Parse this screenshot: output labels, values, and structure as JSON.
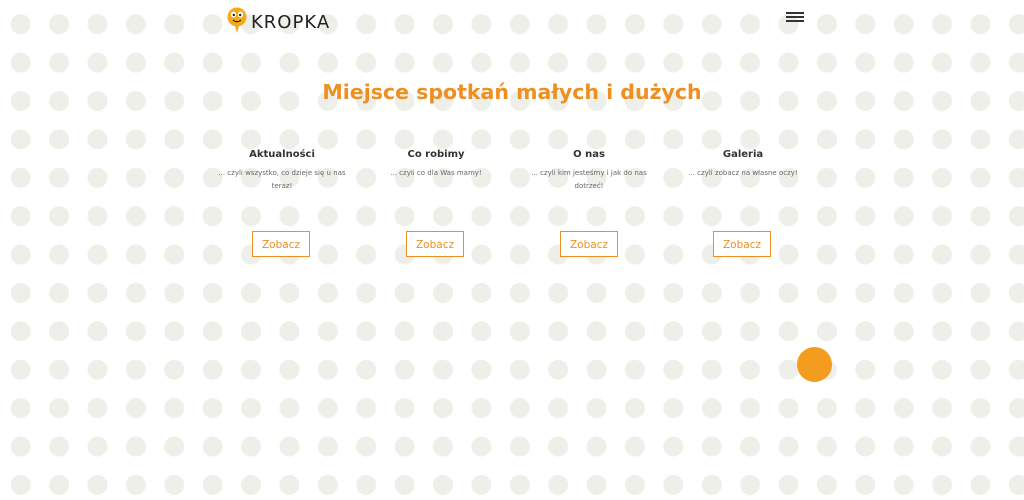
{
  "brand": {
    "name": "KROPKA",
    "logo_icon": "smiling-drop-icon",
    "accent_color": "#ee8f21"
  },
  "header": {
    "menu_icon": "hamburger-menu-icon"
  },
  "hero": {
    "title": "Miejsce spotkań małych i dużych"
  },
  "cards": [
    {
      "title": "Aktualności",
      "description": "... czyli wszystko, co dzieje się u nas teraz!",
      "button_label": "Zobacz"
    },
    {
      "title": "Co robimy",
      "description": "... czyli co dla Was mamy!",
      "button_label": "Zobacz"
    },
    {
      "title": "O nas",
      "description": "... czyli kim jesteśmy i jak do nas dotrzeć!",
      "button_label": "Zobacz"
    },
    {
      "title": "Galeria",
      "description": "... czyli zobacz na własne oczy!",
      "button_label": "Zobacz"
    }
  ],
  "floating_button": {
    "color": "#f39c1e"
  }
}
